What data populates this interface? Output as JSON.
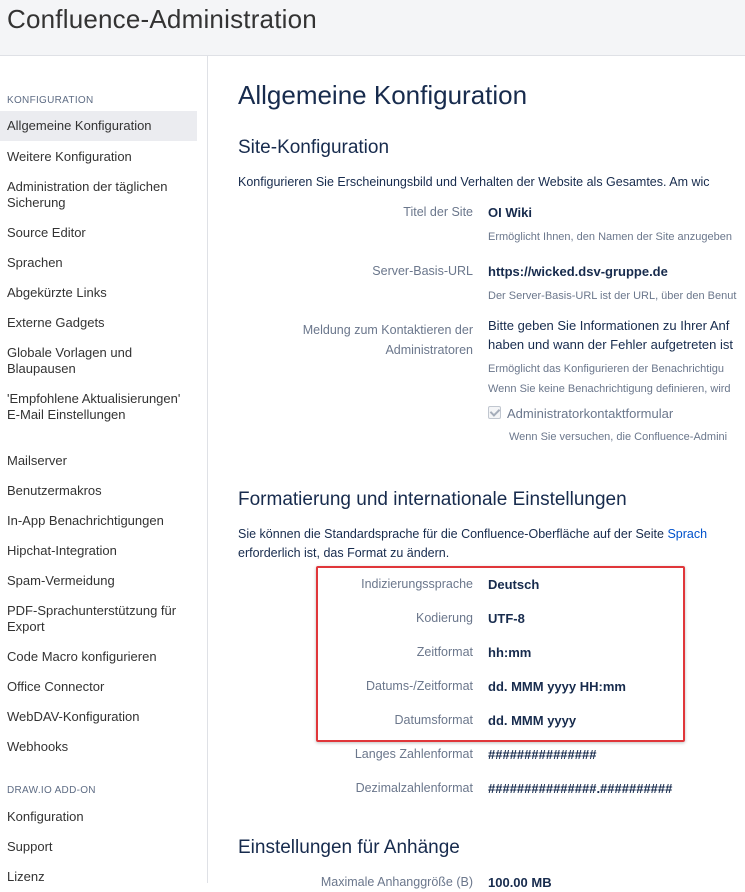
{
  "header": {
    "title": "Confluence-Administration"
  },
  "sidebar": {
    "sections": [
      {
        "heading": "KONFIGURATION",
        "items": [
          "Allgemeine Konfiguration",
          "Weitere Konfiguration",
          "Administration der täglichen Sicherung",
          "Source Editor",
          "Sprachen",
          "Abgekürzte Links",
          "Externe Gadgets",
          "Globale Vorlagen und Blaupausen",
          "'Empfohlene Aktualisierungen' E-Mail Einstellungen",
          "Mailserver",
          "Benutzermakros",
          "In-App Benachrichtigungen",
          "Hipchat-Integration",
          "Spam-Vermeidung",
          "PDF-Sprachunterstützung für Export",
          "Code Macro konfigurieren",
          "Office Connector",
          "WebDAV-Konfiguration",
          "Webhooks"
        ],
        "active_index": 0
      },
      {
        "heading": "DRAW.IO ADD-ON",
        "items": [
          "Konfiguration",
          "Support",
          "Lizenz"
        ]
      }
    ]
  },
  "main": {
    "title": "Allgemeine Konfiguration",
    "site": {
      "heading": "Site-Konfiguration",
      "intro": "Konfigurieren Sie Erscheinungsbild und Verhalten der Website als Gesamtes. Am wic",
      "title_label": "Titel der Site",
      "title_value": "OI Wiki",
      "title_desc": "Ermöglicht Ihnen, den Namen der Site anzugeben",
      "url_label": "Server-Basis-URL",
      "url_value": "https://wicked.dsv-gruppe.de",
      "url_desc": "Der Server-Basis-URL ist der URL, über den Benut",
      "contact_label_1": "Meldung zum Kontaktieren der",
      "contact_label_2": "Administratoren",
      "contact_value_1": "Bitte geben Sie Informationen zu Ihrer Anf",
      "contact_value_2": "haben und wann der Fehler aufgetreten ist",
      "contact_desc_1": "Ermöglicht das Konfigurieren der Benachrichtigu",
      "contact_desc_2": "Wenn Sie keine Benachrichtigung definieren, wird",
      "checkbox_label": "Administratorkontaktformular",
      "checkbox_desc": "Wenn Sie versuchen, die Confluence-Admini"
    },
    "format": {
      "heading": "Formatierung und internationale Einstellungen",
      "intro_1": "Sie können die Standardsprache für die Confluence-Oberfläche auf der Seite ",
      "intro_link": "Sprach",
      "intro_2": "erforderlich ist, das Format zu ändern.",
      "rows": [
        {
          "label": "Indizierungssprache",
          "value": "Deutsch"
        },
        {
          "label": "Kodierung",
          "value": "UTF-8"
        },
        {
          "label": "Zeitformat",
          "value": "hh:mm"
        },
        {
          "label": "Datums-/Zeitformat",
          "value": "dd. MMM yyyy HH:mm"
        },
        {
          "label": "Datumsformat",
          "value": "dd. MMM yyyy"
        },
        {
          "label": "Langes Zahlenformat",
          "value": "###############"
        },
        {
          "label": "Dezimalzahlenformat",
          "value": "###############.##########"
        }
      ]
    },
    "attachments": {
      "heading": "Einstellungen für Anhänge",
      "max_label": "Maximale Anhanggröße (B)",
      "max_value": "100.00 MB"
    }
  },
  "colors": {
    "highlight_border": "#e0363a",
    "link": "#0052cc"
  }
}
